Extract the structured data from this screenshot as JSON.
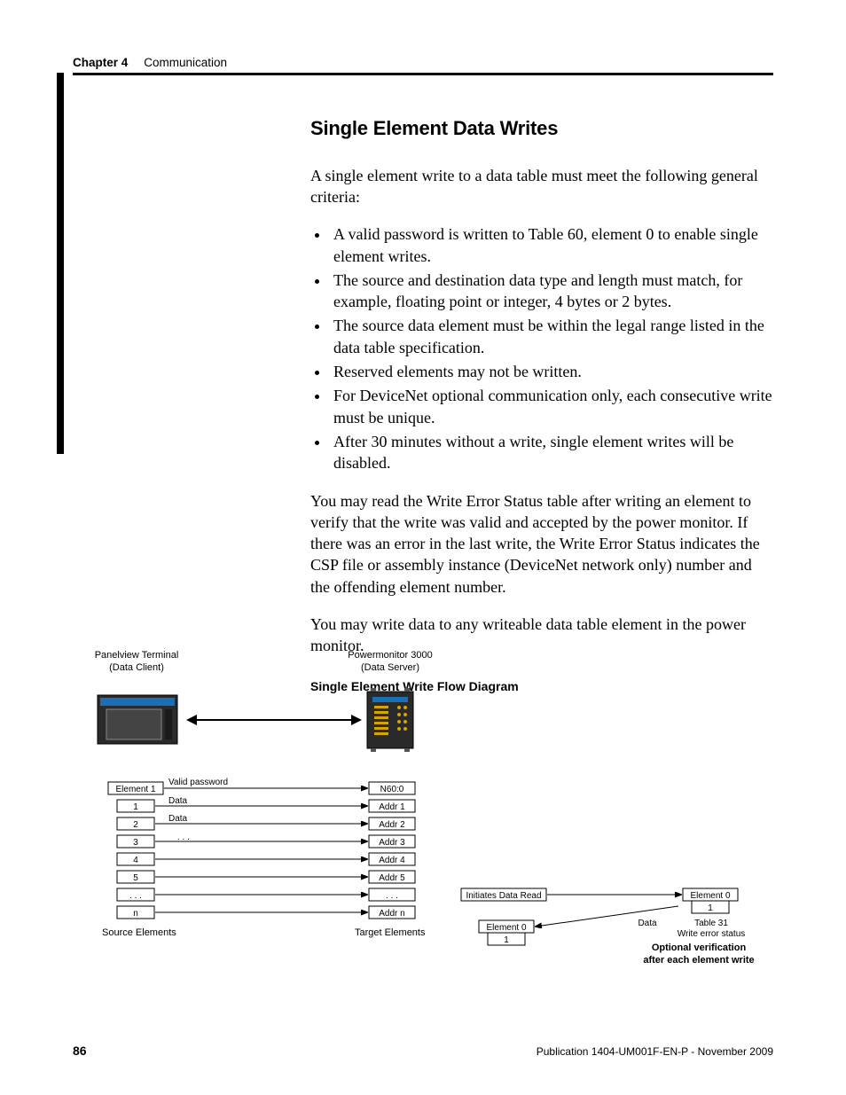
{
  "header": {
    "chapter": "Chapter 4",
    "section": "Communication"
  },
  "section": {
    "title": "Single Element Data Writes",
    "intro": "A single element write to a data table must meet the following general criteria:",
    "bullets": [
      "A valid password is written to Table 60, element 0 to enable single element writes.",
      "The source and destination data type and length must match, for example, floating point or integer, 4 bytes or 2 bytes.",
      "The source data element must be within the legal range listed in the data table specification.",
      "Reserved elements may not be written.",
      "For DeviceNet optional communication only, each consecutive write must be unique.",
      "After 30 minutes without a write, single element writes will be disabled."
    ],
    "post1": "You may read the Write Error Status table after writing an element to verify that the write was valid and accepted by the power monitor. If there was an error in the last write, the Write Error Status indicates the CSP file or assembly instance (DeviceNet network only) number and the offending element number.",
    "post2": "You may write data to any writeable data table element in the power monitor.",
    "diagram_title": "Single Element Write Flow Diagram"
  },
  "diagram": {
    "client_label_top": "Panelview Terminal",
    "client_label_bottom": "(Data Client)",
    "server_label_top": "Powermonitor 3000",
    "server_label_bottom": "(Data Server)",
    "source_label": "Source Elements",
    "target_label": "Target Elements",
    "arrow_labels": {
      "valid_password": "Valid password",
      "data": "Data",
      "dots": ". . ."
    },
    "source_elements": [
      "Element 1",
      "1",
      "2",
      "3",
      "4",
      "5",
      ". . .",
      "n"
    ],
    "target_elements": [
      "N60:0",
      "Addr 1",
      "Addr 2",
      "Addr 3",
      "Addr 4",
      "Addr 5",
      ". . .",
      "Addr n"
    ],
    "right_panel": {
      "initiates": "Initiates Data Read",
      "element0": "Element 0",
      "one": "1",
      "data_lbl": "Data",
      "table31": "Table 31",
      "wes": "Write error status",
      "caption1": "Optional verification",
      "caption2": "after each element write"
    }
  },
  "footer": {
    "page": "86",
    "publication": "Publication 1404-UM001F-EN-P - November 2009"
  }
}
